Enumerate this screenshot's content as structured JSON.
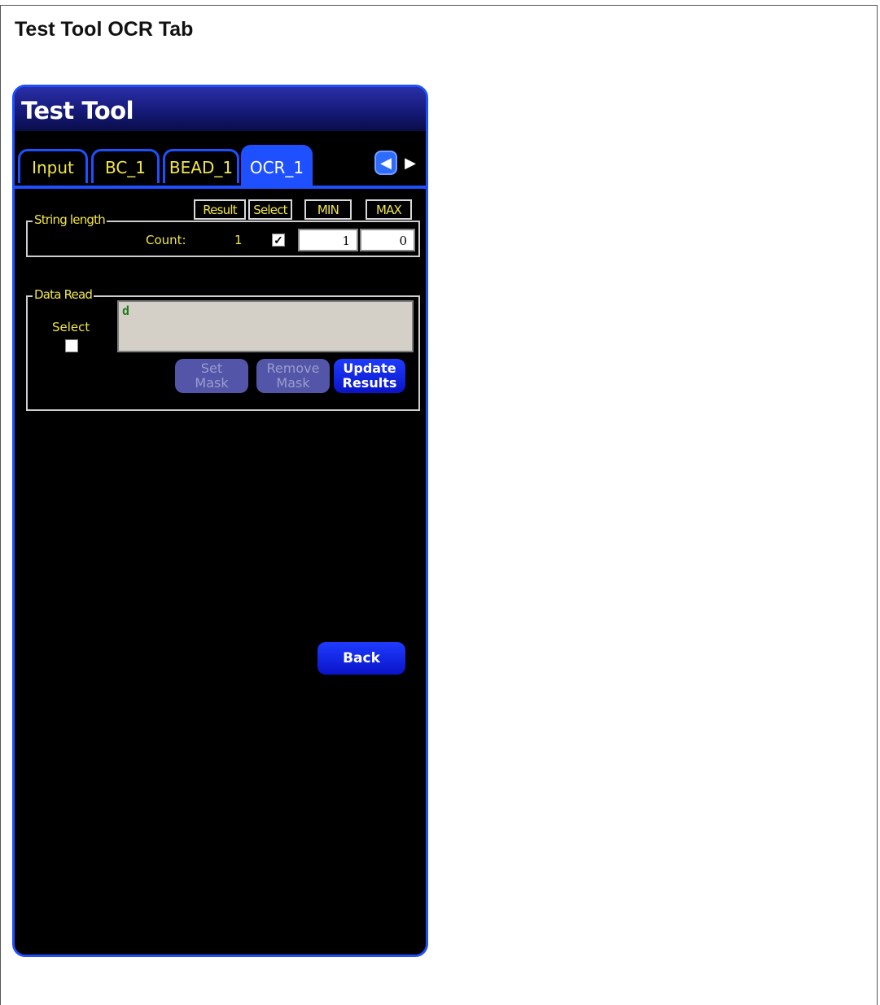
{
  "document": {
    "title": "Test Tool OCR Tab"
  },
  "window": {
    "title": "Test Tool"
  },
  "tabs": [
    {
      "label": "Input",
      "active": false
    },
    {
      "label": "BC_1",
      "active": false
    },
    {
      "label": "BEAD_1",
      "active": false
    },
    {
      "label": "OCR_1",
      "active": true
    }
  ],
  "tab_scroll": {
    "left_icon": "arrow-left-icon",
    "right_icon": "arrow-right-icon"
  },
  "columns": {
    "result": "Result",
    "select": "Select",
    "min": "MIN",
    "max": "MAX"
  },
  "string_length": {
    "label": "String length",
    "count_label": "Count:",
    "count_result": "1",
    "selected": true,
    "min": "1",
    "max": "0"
  },
  "data_read": {
    "label": "Data Read",
    "select_label": "Select",
    "selected": false,
    "value": "d"
  },
  "buttons": {
    "set_mask": [
      "Set",
      "Mask"
    ],
    "remove_mask": [
      "Remove",
      "Mask"
    ],
    "update_results": [
      "Update",
      "Results"
    ],
    "back": "Back"
  },
  "colors": {
    "accent": "#1e50ff",
    "label": "#f2e64a",
    "background": "#000000"
  }
}
